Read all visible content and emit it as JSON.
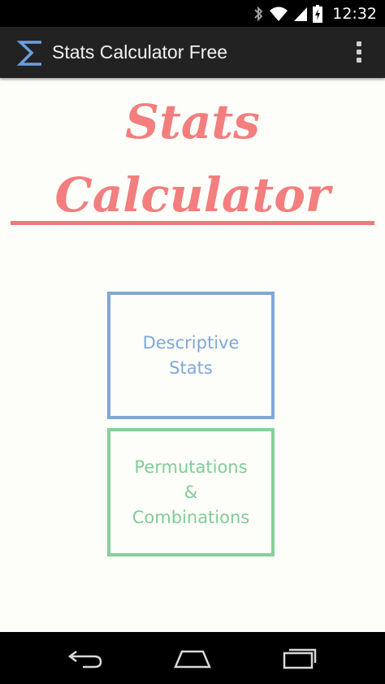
{
  "status_bar": {
    "time": "12:32",
    "icons": [
      "bluetooth-icon",
      "wifi-icon",
      "signal-icon",
      "battery-charging-icon"
    ]
  },
  "action_bar": {
    "app_icon": "sigma-icon",
    "title": "Stats Calculator Free",
    "overflow_icon": "overflow-menu-icon"
  },
  "hero": {
    "line1": "Stats",
    "line2": "Calculator"
  },
  "tiles": [
    {
      "label": "Descriptive\nStats"
    },
    {
      "label": "Permutations\n&\nCombinations"
    }
  ],
  "nav_bar": {
    "buttons": [
      "back-icon",
      "home-icon",
      "recent-apps-icon"
    ]
  },
  "colors": {
    "accent_red": "#f27e7e",
    "tile_blue": "#7ea8da",
    "tile_green": "#7fcd97",
    "action_bar": "#222222"
  }
}
